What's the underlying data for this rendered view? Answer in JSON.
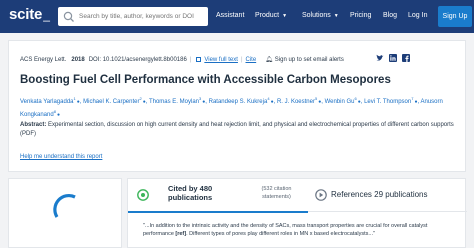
{
  "nav": {
    "logo": "scite",
    "logo_suffix": "_",
    "search_placeholder": "Search by title, author, keywords or DOI",
    "links": {
      "assistant": "Assistant",
      "product": "Product",
      "solutions": "Solutions",
      "pricing": "Pricing",
      "blog": "Blog",
      "login": "Log In"
    },
    "signup": "Sign Up"
  },
  "article": {
    "journal": "ACS Energy Lett.",
    "year": "2018",
    "doi": "DOI: 10.1021/acsenergylett.8b00186",
    "view_full_text": "View full text",
    "cite": "Cite",
    "alert": "Sign up to set email alerts",
    "title": "Boosting Fuel Cell Performance with Accessible Carbon Mesopores",
    "authors": [
      {
        "name": "Venkata Yarlagadda",
        "sup": "1"
      },
      {
        "name": "Michael K. Carpenter",
        "sup": "2"
      },
      {
        "name": "Thomas E. Moylan",
        "sup": "3"
      },
      {
        "name": "Ratandeep S. Kukreja",
        "sup": "4"
      },
      {
        "name": "R. J. Koestner",
        "sup": "5"
      },
      {
        "name": "Wenbin Gu",
        "sup": "6"
      },
      {
        "name": "Levi T. Thompson",
        "sup": "7"
      },
      {
        "name": "Anusorn Kongkanand",
        "sup": "8"
      }
    ],
    "abstract_label": "Abstract:",
    "abstract_text": " Experimental section, discussion on high current density and heat rejection limit, and physical and electrochemical properties of different carbon supports (PDF)",
    "help_link": "Help me understand this report"
  },
  "citations": {
    "cited_by": "Cited by 480",
    "publications": "publications",
    "citation_statements": "(532 citation statements)",
    "references": "References 29 publications",
    "quote_prefix": "\"...In addition to the intrinsic activity and the density of SACs, mass transport properties are crucial for overall catalyst performance ",
    "quote_ref": "[ref]",
    "quote_suffix": ". Different types of pores play different roles in MN x based electrocatalysts...\""
  },
  "colors": {
    "nav_bg": "#1d3d78",
    "accent": "#1a7ccc",
    "link": "#1a6fc4"
  }
}
